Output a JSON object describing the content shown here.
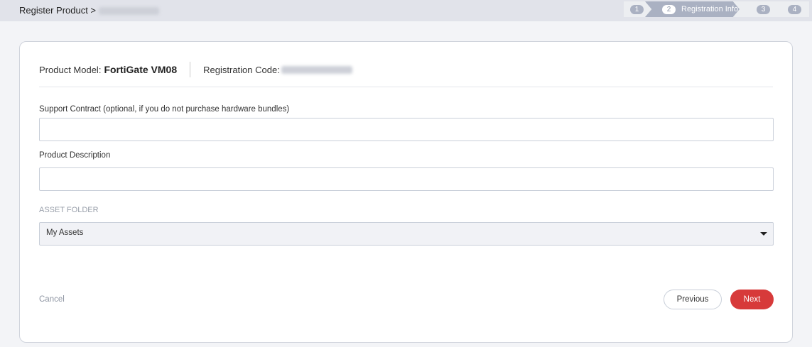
{
  "breadcrumb": {
    "label": "Register Product >"
  },
  "steps": [
    {
      "num": "1"
    },
    {
      "num": "2",
      "label": "Registration Info"
    },
    {
      "num": "3"
    },
    {
      "num": "4"
    }
  ],
  "header": {
    "model_label": "Product Model:",
    "model_value": "FortiGate VM08",
    "code_label": "Registration Code:"
  },
  "form": {
    "support_label": "Support Contract (optional, if you do not purchase hardware bundles)",
    "support_value": "",
    "desc_label": "Product Description",
    "desc_value": "",
    "folder_label": "ASSET FOLDER",
    "folder_value": "My Assets"
  },
  "actions": {
    "cancel": "Cancel",
    "previous": "Previous",
    "next": "Next"
  }
}
